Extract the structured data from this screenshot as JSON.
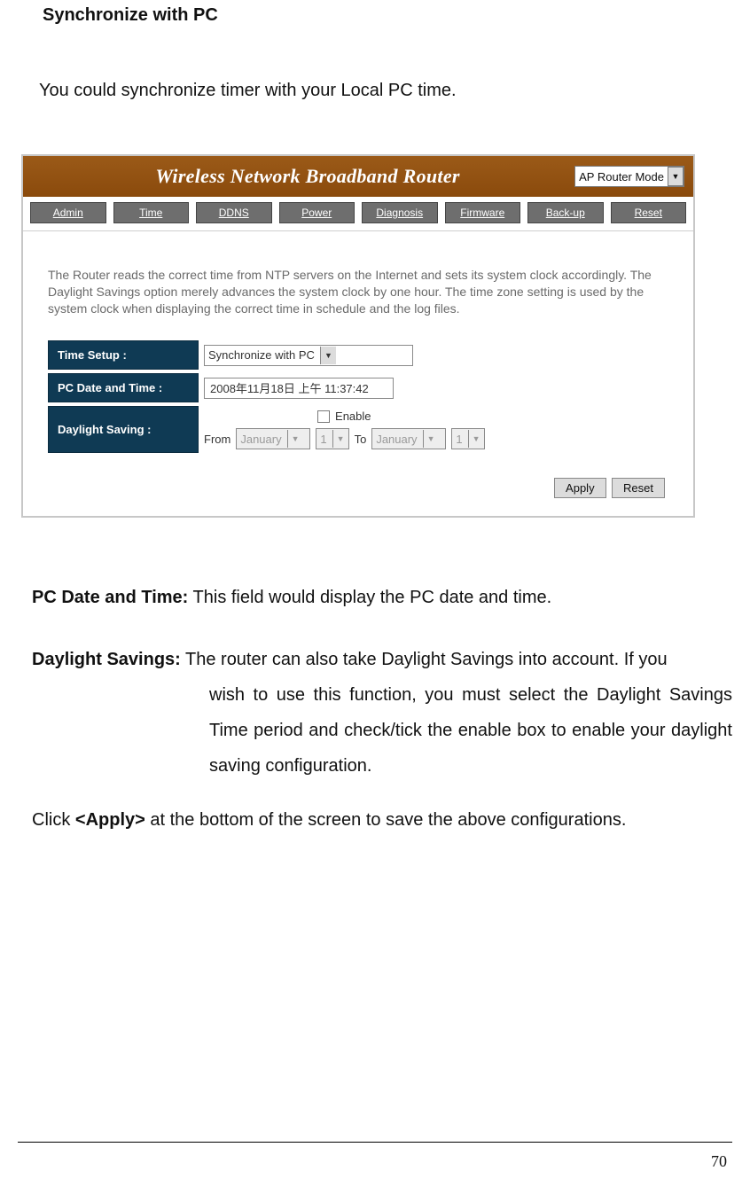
{
  "doc": {
    "heading": "Synchronize with PC",
    "intro": "You could synchronize timer with your Local PC time.",
    "pc_date_label": "PC Date and Time:",
    "pc_date_text": " This field would display the PC date and time.",
    "daylight_label": "Daylight Savings:",
    "daylight_text_first": " The router can also take Daylight Savings into account. If you",
    "daylight_text_rest": "wish to use this function, you must select the Daylight Savings Time period and check/tick the enable box to enable your daylight saving configuration.",
    "click_prefix": "Click ",
    "click_apply": "<Apply>",
    "click_suffix": " at the bottom of the screen to save the above configurations.",
    "page_number": "70"
  },
  "router": {
    "title": "Wireless Network Broadband Router",
    "mode": "AP Router Mode",
    "tabs": [
      "Admin",
      "Time",
      "DDNS",
      "Power",
      "Diagnosis",
      "Firmware",
      "Back-up",
      "Reset"
    ],
    "description": "The Router reads the correct time from NTP servers on the Internet and sets its system clock accordingly. The Daylight Savings option merely advances the system clock by one hour. The time zone setting is used by the system clock when displaying the correct time in schedule and the log files.",
    "form": {
      "time_setup": {
        "label": "Time Setup :",
        "value": "Synchronize with PC"
      },
      "pc_date": {
        "label": "PC Date and Time :",
        "value": "2008年11月18日 上午 11:37:42"
      },
      "daylight": {
        "label": "Daylight Saving :",
        "enable_text": "Enable",
        "from_text": "From",
        "to_text": "To",
        "from_month": "January",
        "from_day": "1",
        "to_month": "January",
        "to_day": "1"
      }
    },
    "buttons": {
      "apply": "Apply",
      "reset": "Reset"
    }
  }
}
